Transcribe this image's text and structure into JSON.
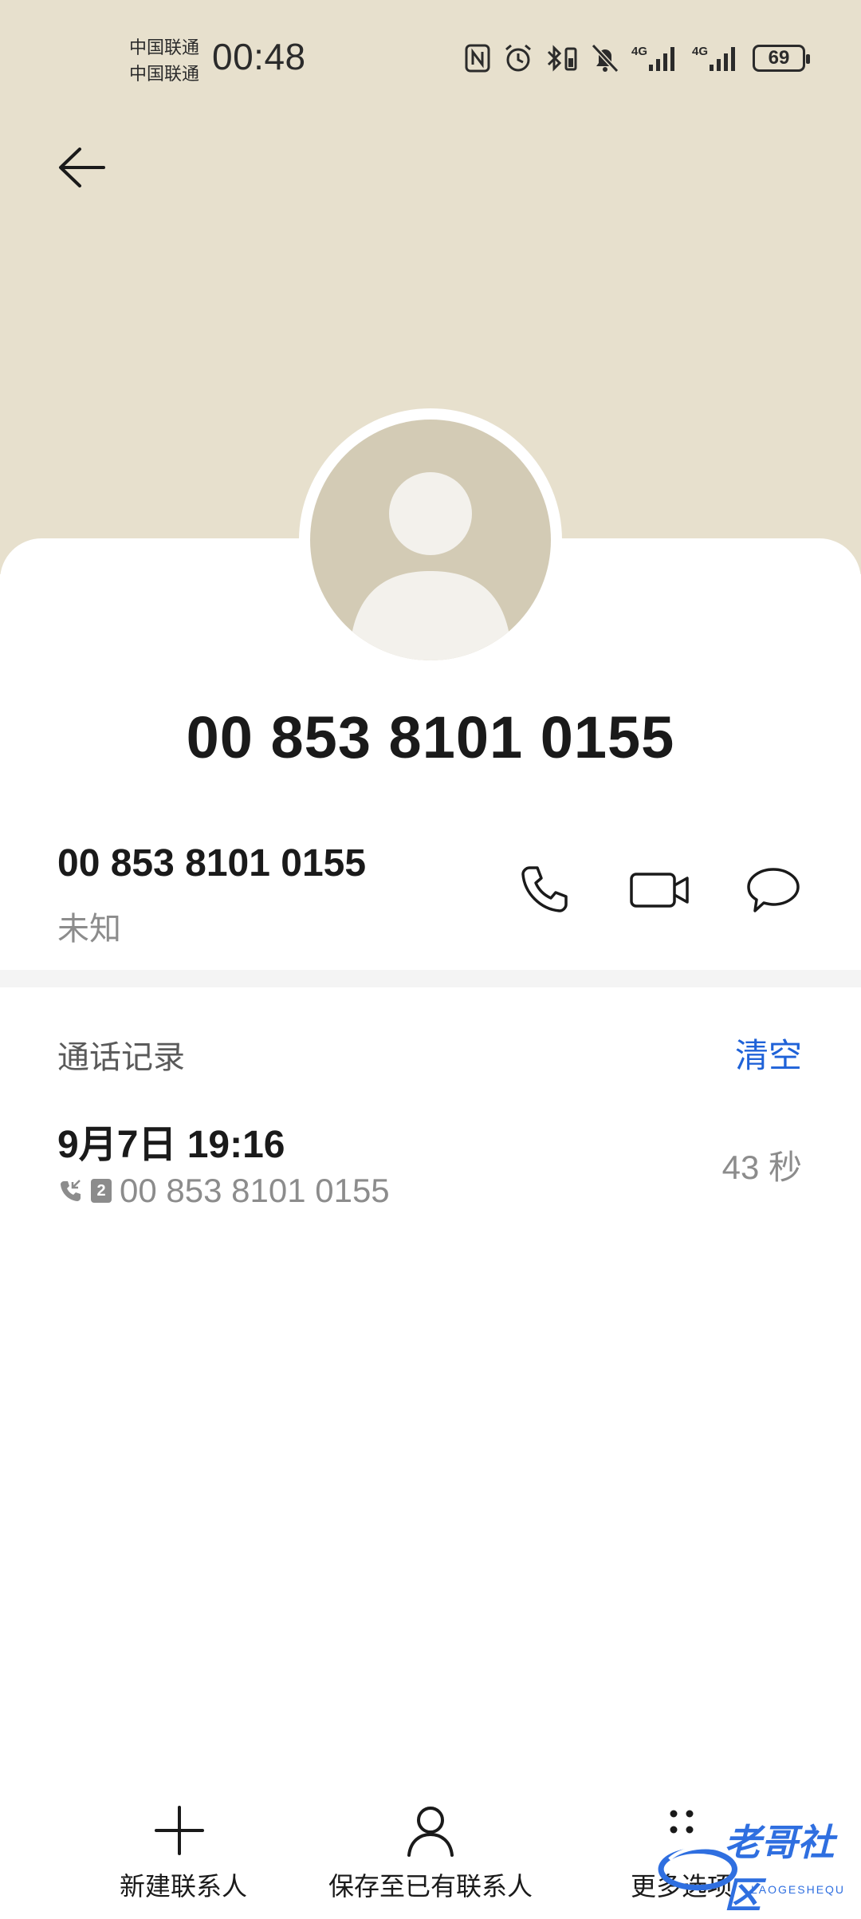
{
  "status_bar": {
    "carrier_1": "中国联通",
    "carrier_2": "中国联通",
    "time": "00:48",
    "network_1": "4G",
    "network_2": "4G",
    "battery": "69"
  },
  "contact": {
    "title_number": "00 853 8101 0155",
    "number": "00 853 8101 0155",
    "number_label": "未知"
  },
  "call_log": {
    "section_title": "通话记录",
    "clear_label": "清空",
    "records": [
      {
        "datetime": "9月7日 19:16",
        "sim": "2",
        "number": "00 853 8101 0155",
        "duration": "43 秒"
      }
    ]
  },
  "bottom_bar": {
    "new_contact": "新建联系人",
    "save_existing": "保存至已有联系人",
    "more_options": "更多选项"
  },
  "watermark": {
    "text": "老哥社区",
    "sub": "LAOGESHEQU"
  },
  "colors": {
    "header_bg": "#e7e0cd",
    "avatar_bg": "#d3cbb5",
    "accent_link": "#1f62d8"
  }
}
